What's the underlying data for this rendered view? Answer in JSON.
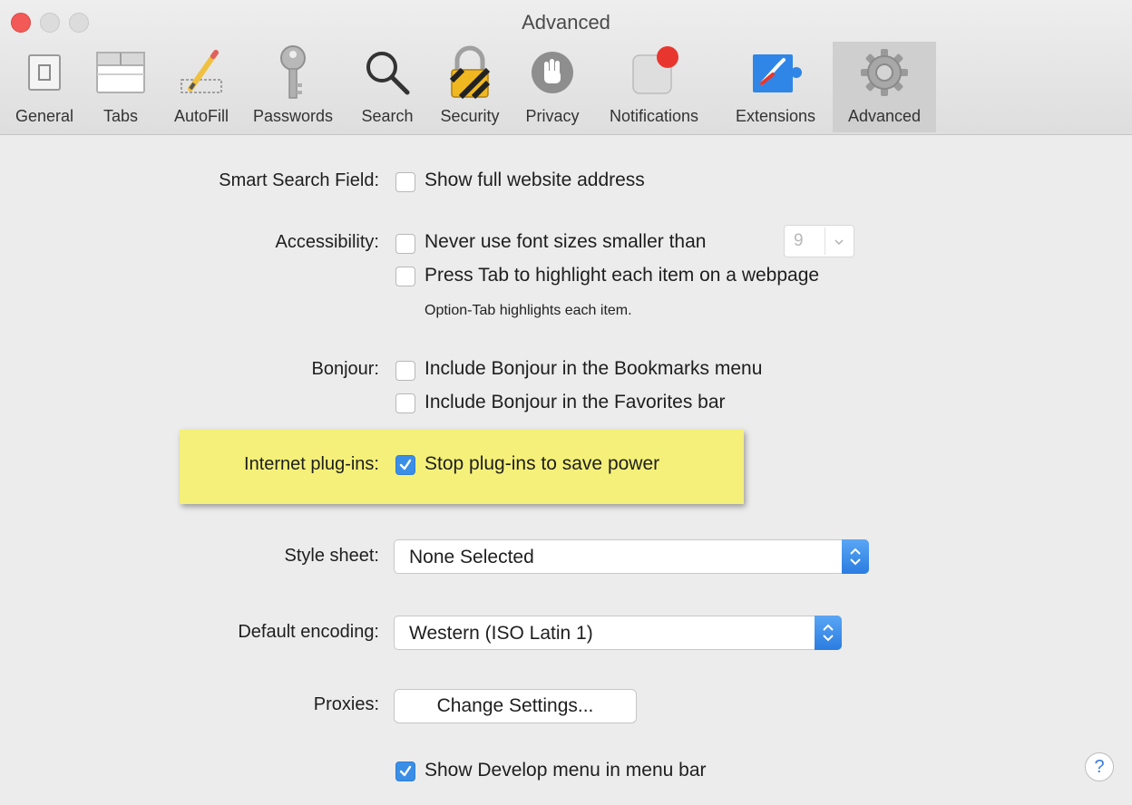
{
  "window": {
    "title": "Advanced"
  },
  "toolbar": {
    "tabs": [
      {
        "label": "General",
        "icon": "general-icon"
      },
      {
        "label": "Tabs",
        "icon": "tabs-icon"
      },
      {
        "label": "AutoFill",
        "icon": "pencil-icon"
      },
      {
        "label": "Passwords",
        "icon": "key-icon"
      },
      {
        "label": "Search",
        "icon": "magnifier-icon"
      },
      {
        "label": "Security",
        "icon": "lock-icon"
      },
      {
        "label": "Privacy",
        "icon": "hand-icon"
      },
      {
        "label": "Notifications",
        "icon": "notification-icon"
      },
      {
        "label": "Extensions",
        "icon": "puzzle-icon"
      },
      {
        "label": "Advanced",
        "icon": "gear-icon",
        "selected": true
      }
    ]
  },
  "settings": {
    "smart_search": {
      "label": "Smart Search Field:",
      "option": "Show full website address",
      "checked": false
    },
    "accessibility": {
      "label": "Accessibility:",
      "option1": "Never use font sizes smaller than",
      "option1_checked": false,
      "font_size_value": "9",
      "option2": "Press Tab to highlight each item on a webpage",
      "option2_checked": false,
      "note": "Option-Tab highlights each item."
    },
    "bonjour": {
      "label": "Bonjour:",
      "option1": "Include Bonjour in the Bookmarks menu",
      "option1_checked": false,
      "option2": "Include Bonjour in the Favorites bar",
      "option2_checked": false
    },
    "plugins": {
      "label": "Internet plug-ins:",
      "option": "Stop plug-ins to save power",
      "checked": true
    },
    "style_sheet": {
      "label": "Style sheet:",
      "value": "None Selected"
    },
    "encoding": {
      "label": "Default encoding:",
      "value": "Western (ISO Latin 1)"
    },
    "proxies": {
      "label": "Proxies:",
      "button": "Change Settings..."
    },
    "develop": {
      "option": "Show Develop menu in menu bar",
      "checked": true
    }
  },
  "help": {
    "label": "?"
  },
  "colors": {
    "highlight": "#f4f07a",
    "accent": "#3a8ee6",
    "close": "#f25a57"
  }
}
